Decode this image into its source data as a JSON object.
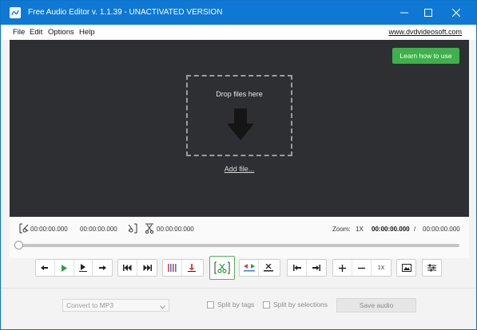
{
  "window": {
    "title": "Free Audio Editor v. 1.1.39 - UNACTIVATED VERSION",
    "accent_color": "#0f78d4"
  },
  "menu": {
    "items": [
      "File",
      "Edit",
      "Options",
      "Help"
    ],
    "site_link": "www.dvdvideosoft.com"
  },
  "drop_area": {
    "learn_button": "Learn how to use",
    "drop_text": "Drop files here",
    "add_file": "Add file...",
    "background_color": "#2d2f33",
    "learn_button_color": "#3fb04b"
  },
  "time_controls": {
    "selection_start": "00:00:00.000",
    "selection_end": "00:00:00.000",
    "selection_length": "00:00:00.000",
    "zoom_label": "Zoom:",
    "zoom_value": "1X",
    "current_time": "00:00:00.000",
    "separator": "/",
    "total_time": "00:00:00.000",
    "playhead_fraction": 0
  },
  "toolbar": {
    "icons": [
      "rewind-back-icon",
      "play-icon",
      "play-selection-icon",
      "forward-icon",
      "skip-start-icon",
      "skip-end-icon",
      "equalizer-icon",
      "download-icon",
      "split-scissors-icon",
      "copy-paste-icon",
      "delete-icon",
      "go-start-icon",
      "go-end-icon",
      "zoom-in-icon",
      "zoom-out-icon",
      "zoom-reset-icon",
      "image-icon",
      "settings-sliders-icon"
    ],
    "zoom_reset_label": "1X"
  },
  "footer": {
    "format": "Convert to MP3",
    "split_by_tags": "Split by tags",
    "split_by_selections": "Split by selections",
    "save_audio": "Save audio"
  }
}
